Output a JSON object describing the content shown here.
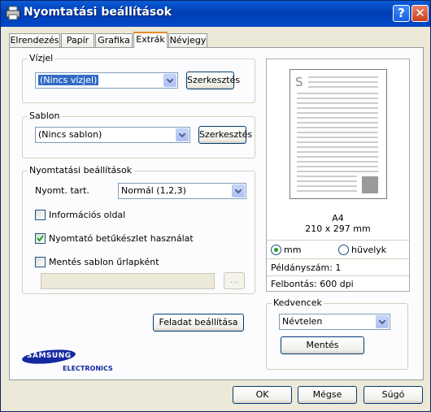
{
  "window": {
    "title": "Nyomtatási beállítások",
    "help_glyph": "?",
    "close_glyph": "✕"
  },
  "tabs": [
    {
      "label": "Elrendezés"
    },
    {
      "label": "Papír"
    },
    {
      "label": "Grafika"
    },
    {
      "label": "Extrák"
    },
    {
      "label": "Névjegy"
    }
  ],
  "watermark": {
    "legend": "Vízjel",
    "selected": "(Nincs vízjel)",
    "edit_label": "Szerkesztés"
  },
  "overlay": {
    "legend": "Sablon",
    "selected": "(Nincs sablon)",
    "edit_label": "Szerkesztés"
  },
  "output": {
    "legend": "Nyomtatási beállítások",
    "print_order_label": "Nyomt. tart.",
    "print_order_value": "Normál (1,2,3)",
    "info_page_label": "Információs oldal",
    "info_page_checked": false,
    "use_printer_fonts_label": "Nyomtató betűkészlet használat",
    "use_printer_fonts_checked": true,
    "save_template_label": "Mentés sablon űrlapként",
    "save_template_checked": false,
    "browse_label": "...",
    "job_options_label": "Feladat beállítása"
  },
  "preview": {
    "page_letter": "S",
    "paper_name": "A4",
    "paper_size": "210 x 297 mm",
    "unit_mm": "mm",
    "unit_inch": "hüvelyk",
    "unit_selected": "mm",
    "copies": "Példányszám: 1",
    "resolution": "Felbontás: 600 dpi"
  },
  "favorites": {
    "legend": "Kedvencek",
    "selected": "Névtelen",
    "save_label": "Mentés"
  },
  "logo": {
    "brand": "SAMSUNG",
    "sub": "ELECTRONICS"
  },
  "buttons": {
    "ok": "OK",
    "cancel": "Mégse",
    "help": "Súgó"
  },
  "colors": {
    "title_bar": "#0a5cd6",
    "accent_tab": "#e68b2c",
    "select_highlight": "#316ac5",
    "samsung_blue": "#1428a0"
  }
}
